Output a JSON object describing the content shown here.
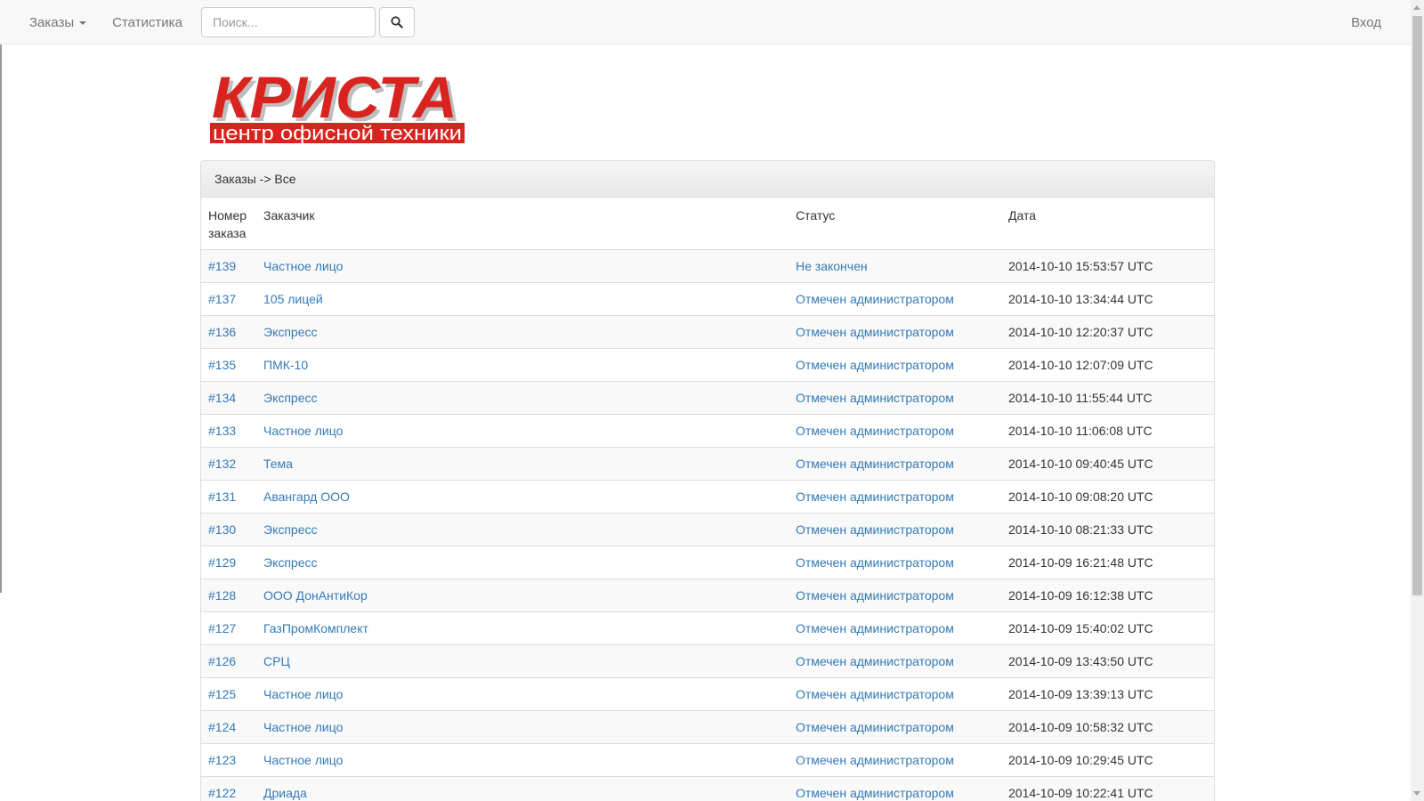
{
  "navbar": {
    "orders_label": "Заказы",
    "stats_label": "Статистика",
    "search_placeholder": "Поиск...",
    "login_label": "Вход"
  },
  "logo": {
    "title": "КРИСТА",
    "subtitle": "центр офисной техники",
    "colors": {
      "brand_red": "#d8231f",
      "white": "#ffffff"
    }
  },
  "panel": {
    "breadcrumb": "Заказы -> Все"
  },
  "table": {
    "headers": {
      "number": "Номер заказа",
      "customer": "Заказчик",
      "status": "Статус",
      "date": "Дата"
    },
    "rows": [
      {
        "number": "#139",
        "customer": "Частное лицо",
        "status": "Не закончен",
        "date": "2014-10-10 15:53:57 UTC"
      },
      {
        "number": "#137",
        "customer": "105 лицей",
        "status": "Отмечен администратором",
        "date": "2014-10-10 13:34:44 UTC"
      },
      {
        "number": "#136",
        "customer": "Экспресс",
        "status": "Отмечен администратором",
        "date": "2014-10-10 12:20:37 UTC"
      },
      {
        "number": "#135",
        "customer": "ПМК-10",
        "status": "Отмечен администратором",
        "date": "2014-10-10 12:07:09 UTC"
      },
      {
        "number": "#134",
        "customer": "Экспресс",
        "status": "Отмечен администратором",
        "date": "2014-10-10 11:55:44 UTC"
      },
      {
        "number": "#133",
        "customer": "Частное лицо",
        "status": "Отмечен администратором",
        "date": "2014-10-10 11:06:08 UTC"
      },
      {
        "number": "#132",
        "customer": "Тема",
        "status": "Отмечен администратором",
        "date": "2014-10-10 09:40:45 UTC"
      },
      {
        "number": "#131",
        "customer": "Авангард ООО",
        "status": "Отмечен администратором",
        "date": "2014-10-10 09:08:20 UTC"
      },
      {
        "number": "#130",
        "customer": "Экспресс",
        "status": "Отмечен администратором",
        "date": "2014-10-10 08:21:33 UTC"
      },
      {
        "number": "#129",
        "customer": "Экспресс",
        "status": "Отмечен администратором",
        "date": "2014-10-09 16:21:48 UTC"
      },
      {
        "number": "#128",
        "customer": "ООО ДонАнтиКор",
        "status": "Отмечен администратором",
        "date": "2014-10-09 16:12:38 UTC"
      },
      {
        "number": "#127",
        "customer": "ГазПромКомплект",
        "status": "Отмечен администратором",
        "date": "2014-10-09 15:40:02 UTC"
      },
      {
        "number": "#126",
        "customer": "СРЦ",
        "status": "Отмечен администратором",
        "date": "2014-10-09 13:43:50 UTC"
      },
      {
        "number": "#125",
        "customer": "Частное лицо",
        "status": "Отмечен администратором",
        "date": "2014-10-09 13:39:13 UTC"
      },
      {
        "number": "#124",
        "customer": "Частное лицо",
        "status": "Отмечен администратором",
        "date": "2014-10-09 10:58:32 UTC"
      },
      {
        "number": "#123",
        "customer": "Частное лицо",
        "status": "Отмечен администратором",
        "date": "2014-10-09 10:29:45 UTC"
      },
      {
        "number": "#122",
        "customer": "Дриада",
        "status": "Отмечен администратором",
        "date": "2014-10-09 10:22:41 UTC"
      }
    ]
  },
  "icons": {
    "search": "search-icon",
    "dropdown": "caret-down-icon"
  }
}
